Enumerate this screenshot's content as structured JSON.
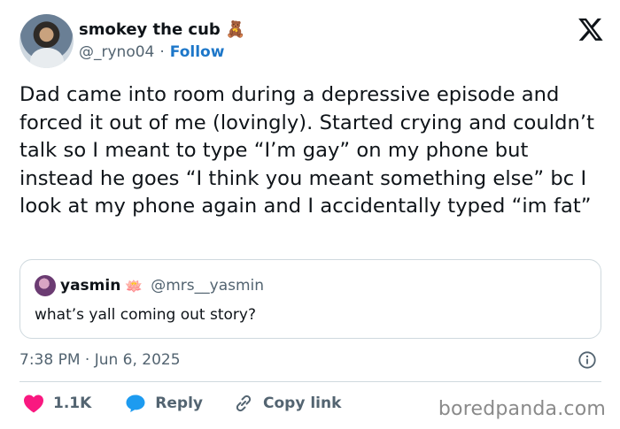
{
  "author": {
    "name": "smokey the cub",
    "emoji": "🧸",
    "handle": "@_ryno04",
    "separator": "·",
    "follow_label": "Follow"
  },
  "tweet": {
    "text": "Dad came into room during a depressive episode and forced it out of me (lovingly). Started crying and couldn’t talk so I meant to type “I’m gay” on my phone but instead he goes “I think you meant something else” bc I look at my phone again and I accidentally typed “im fat”"
  },
  "quote": {
    "name": "yasmin",
    "emoji": "🪷",
    "handle": "@mrs__yasmin",
    "text": "what’s yall coming out story?"
  },
  "timestamp": "7:38 PM · Jun 6, 2025",
  "actions": {
    "like_count": "1.1K",
    "reply_label": "Reply",
    "copy_label": "Copy link"
  },
  "watermark": "boredpanda.com",
  "colors": {
    "like": "#f91880",
    "reply": "#1d9bf0",
    "follow": "#1d77c9",
    "secondary_text": "#536471"
  }
}
